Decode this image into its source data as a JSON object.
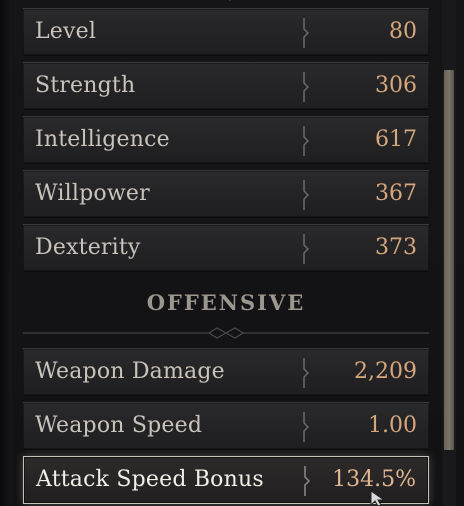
{
  "stats_core": [
    {
      "label": "Level",
      "value": "80"
    },
    {
      "label": "Strength",
      "value": "306"
    },
    {
      "label": "Intelligence",
      "value": "617"
    },
    {
      "label": "Willpower",
      "value": "367"
    },
    {
      "label": "Dexterity",
      "value": "373"
    }
  ],
  "section": {
    "title": "OFFENSIVE"
  },
  "stats_offensive": [
    {
      "label": "Weapon Damage",
      "value": "2,209"
    },
    {
      "label": "Weapon Speed",
      "value": "1.00"
    },
    {
      "label": "Attack Speed Bonus",
      "value": "134.5%"
    }
  ],
  "colors": {
    "label_text": "#c9c3ba",
    "value_text": "#d7a77c",
    "section_title": "#9c968e",
    "selection_border": "#c9c2b8"
  },
  "icons": [
    "divider-arrow-icon",
    "mouse-cursor-icon",
    "ornament-icon"
  ]
}
